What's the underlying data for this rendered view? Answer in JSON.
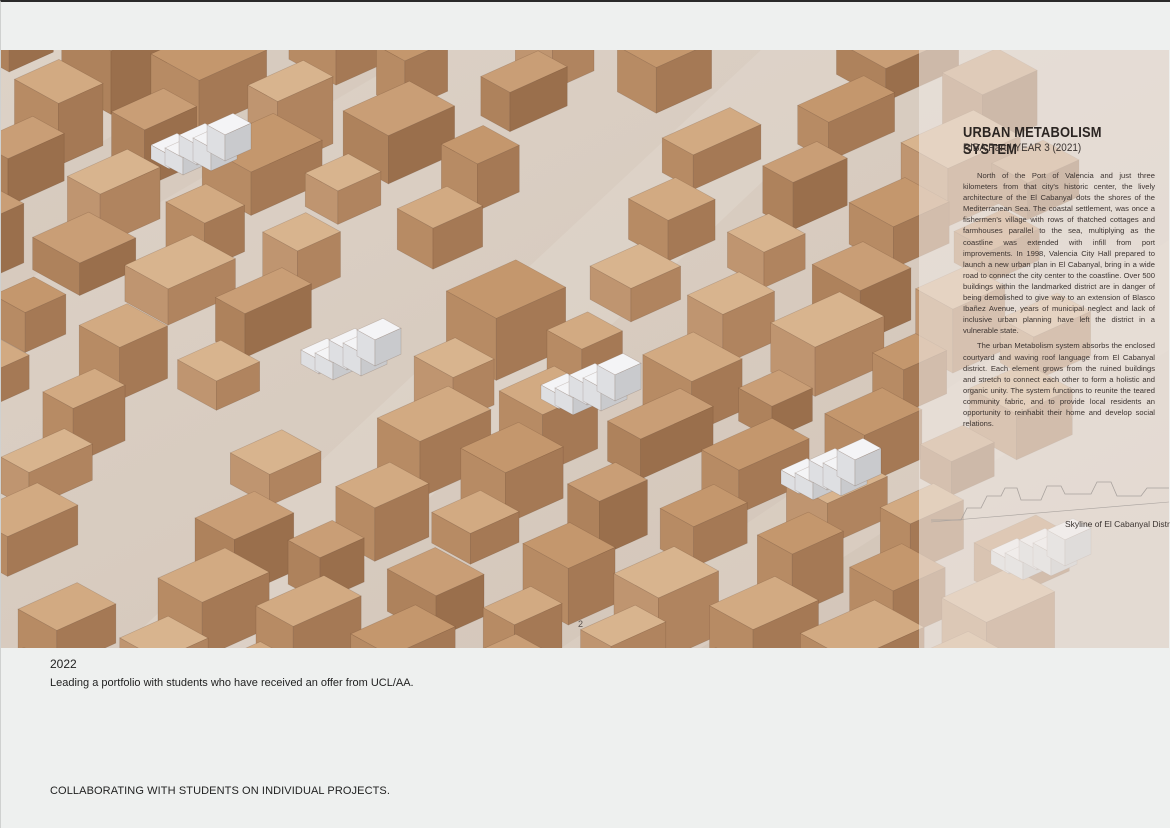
{
  "page": {
    "background": "#eef0ef"
  },
  "image_panel": {
    "title": "URBAN METABOLISM SYSTEM",
    "subtitle": "RIBA Part I YEAR 3 (2021)",
    "paragraphs": [
      "North of the Port of Valencia and just three kilometers from that city's historic center, the lively architecture of the El Cabanyal dots the shores of the Mediterranean Sea. The coastal settlement, was once a fishermen's village with rows of thatched cottages and farmhouses parallel to the sea, multiplying as the coastline was extended with infill from port improvements. In 1998, Valencia City Hall prepared to launch a new urban plan in El Cabanyal, bring in a wide road to connect the city center to the coastline. Over 500 buildings within the landmarked district are in danger of being demolished to give way to an extension of Blasco Ibañez Avenue, years of municipal neglect and lack of inclusive urban planning have left the district in a vulnerable state.",
      "The urban Metabolism system absorbs the enclosed courtyard and waving roof language from El Cabanyal district. Each element grows from the ruined buildings and stretch to connect each other to form a holistic and organic unity. The system functions to reunite the teared community fabric, and to provide local residents an opportunity to reinhabit their home and develop social relations."
    ],
    "skyline_caption": "Skyline of El Cabanyal District",
    "page_number": "2",
    "colors": {
      "wood": "#c49a74",
      "wood_shade": "#9c7352",
      "street": "#d8cbbf",
      "white_intervention": "#f1f1f3"
    }
  },
  "content": {
    "year": "2022",
    "lead": "Leading a portfolio with students who have received an offer from UCL/AA.",
    "footer": "COLLABORATING WITH STUDENTS ON INDIVIDUAL PROJECTS."
  }
}
